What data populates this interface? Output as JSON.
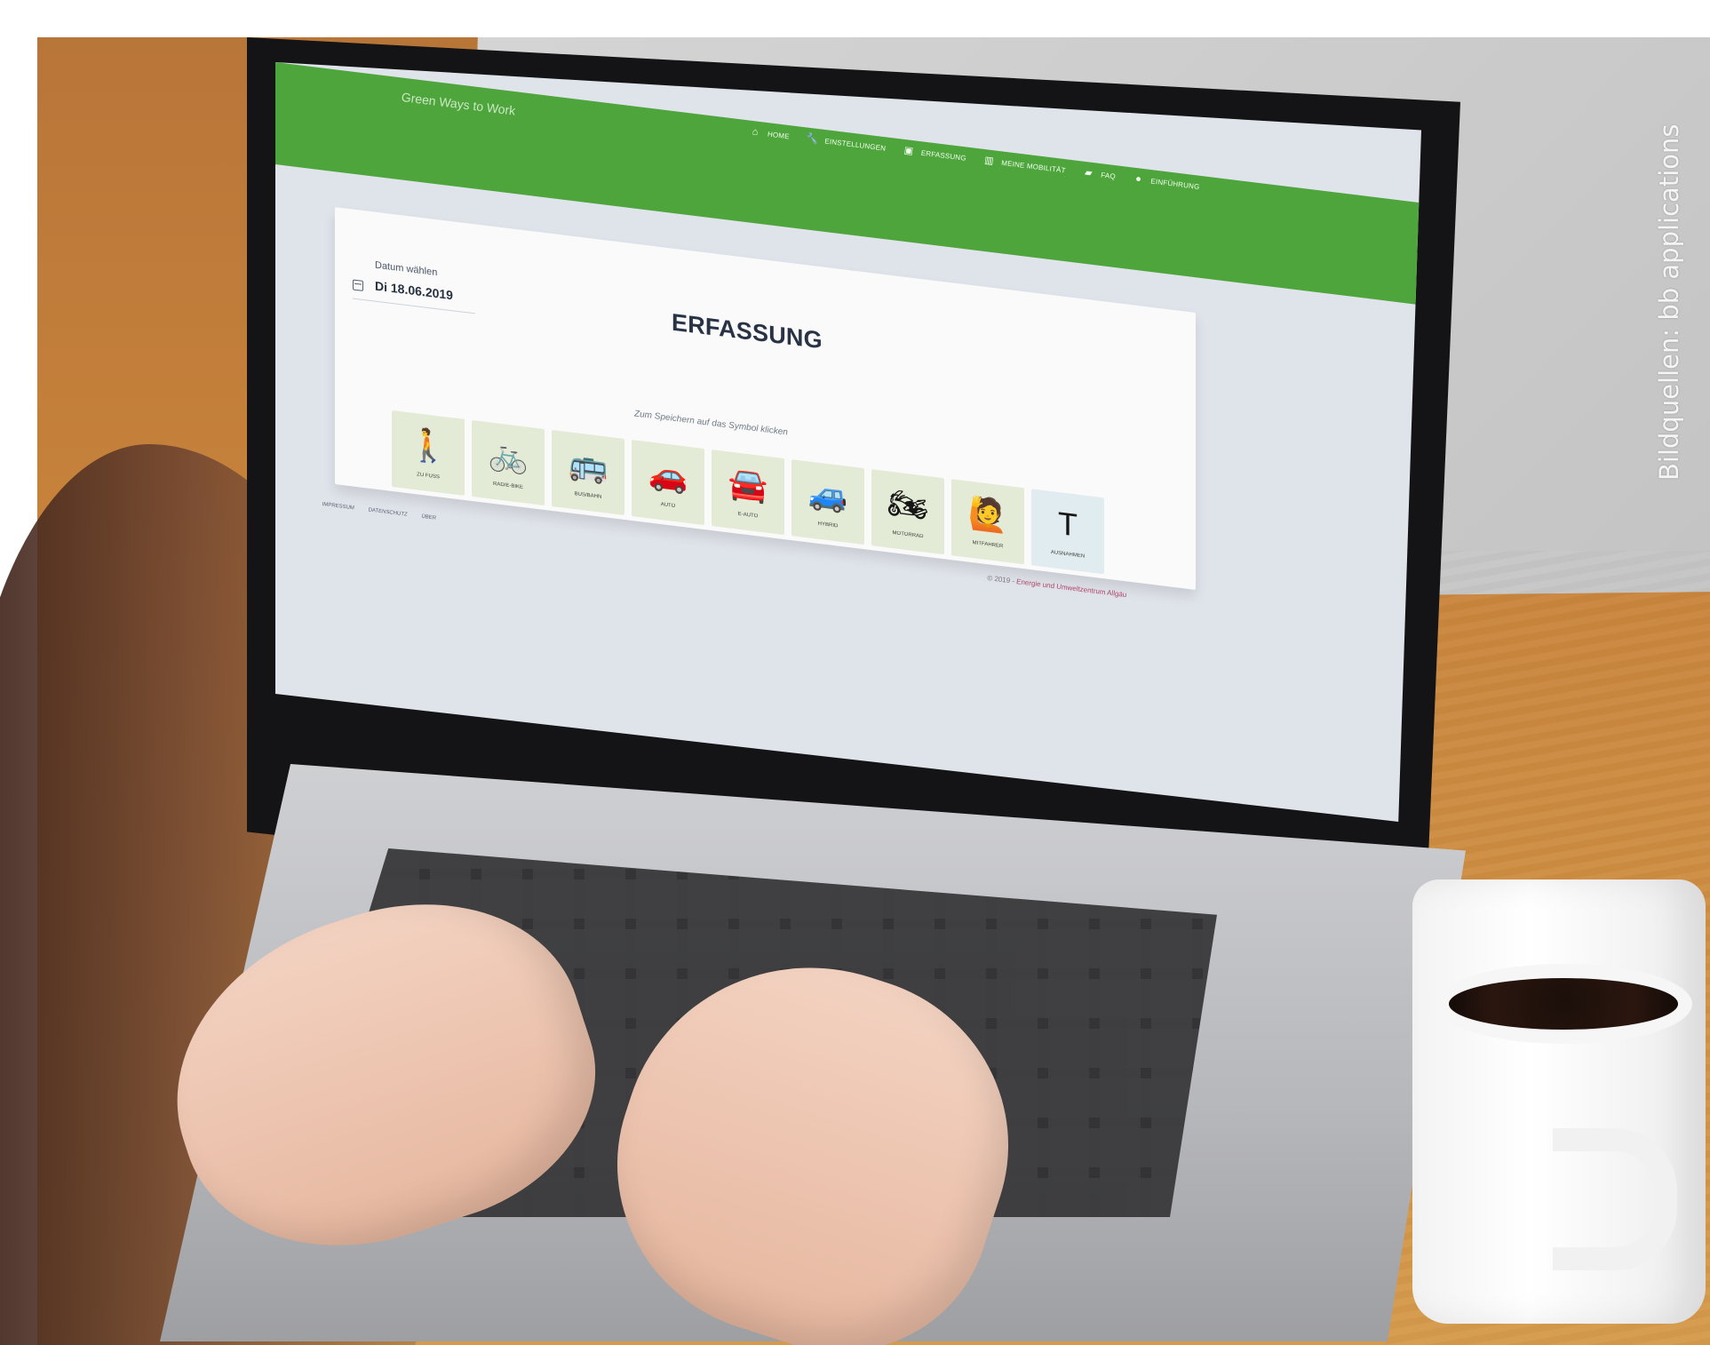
{
  "app": {
    "title": "Green Ways to Work",
    "nav": [
      {
        "label": "Home",
        "icon": "home-icon"
      },
      {
        "label": "Einstellungen",
        "icon": "wrench-icon"
      },
      {
        "label": "Erfassung",
        "icon": "calendar-icon"
      },
      {
        "label": "Meine Mobilität",
        "icon": "bar-chart-icon"
      },
      {
        "label": "FAQ",
        "icon": "chat-icon"
      },
      {
        "label": "Einführung",
        "icon": "info-icon"
      }
    ],
    "date_label": "Datum wählen",
    "date_value": "Di 18.06.2019",
    "page_title": "ERFASSUNG",
    "hint": "Zum Speichern auf das Symbol klicken",
    "modes": [
      {
        "label": "ZU FUSS",
        "icon": "walk-icon"
      },
      {
        "label": "RAD/E-BIKE",
        "icon": "bike-icon"
      },
      {
        "label": "BUS/BAHN",
        "icon": "bus-icon"
      },
      {
        "label": "AUTO",
        "icon": "car-icon"
      },
      {
        "label": "E-AUTO",
        "icon": "electric-car-icon"
      },
      {
        "label": "HYBRID",
        "icon": "hybrid-car-icon"
      },
      {
        "label": "MOTORRAD",
        "icon": "motorcycle-icon"
      },
      {
        "label": "MITFAHRER",
        "icon": "hitchhiker-icon"
      },
      {
        "label": "AUSNAHMEN",
        "icon": "exception-icon"
      }
    ],
    "footer_links": [
      "IMPRESSUM",
      "DATENSCHUTZ",
      "ÜBER"
    ],
    "copyright_prefix": "© 2019 - ",
    "copyright_org": "Energie und Umweltzentrum Allgäu"
  },
  "credit": "Bildquellen: bb applications"
}
